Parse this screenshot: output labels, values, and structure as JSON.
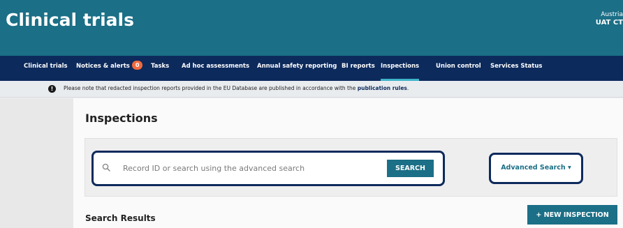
{
  "app": {
    "title": "Clinical trials"
  },
  "org": {
    "country": "Austria",
    "environment": "UAT CT"
  },
  "nav": {
    "items": [
      {
        "label": "Clinical trials"
      },
      {
        "label": "Notices & alerts",
        "badge": "0"
      },
      {
        "label": "Tasks"
      },
      {
        "label": "Ad hoc assessments"
      },
      {
        "label": "Annual safety reporting"
      },
      {
        "label": "BI reports"
      },
      {
        "label": "Inspections",
        "active": true
      },
      {
        "label": "Union control"
      },
      {
        "label": "Services Status"
      }
    ]
  },
  "notice": {
    "icon": "exclamation-circle-icon",
    "text": "Please note that redacted inspection reports provided in the EU Database are published in accordance with the",
    "link": "publication rules",
    "suffix": "."
  },
  "main": {
    "title": "Inspections",
    "search": {
      "icon": "search-icon",
      "placeholder": "Record ID or search using the advanced search",
      "value": "",
      "button_label": "SEARCH"
    },
    "advanced_search": {
      "label": "Advanced Search",
      "caret": "▾"
    },
    "results_title": "Search Results",
    "new_button": {
      "icon": "+",
      "label": "NEW INSPECTION"
    }
  },
  "colors": {
    "header": "#1b6f86",
    "nav": "#0d2a5c",
    "accent": "#3fb4c9",
    "badge": "#f26a3d"
  }
}
